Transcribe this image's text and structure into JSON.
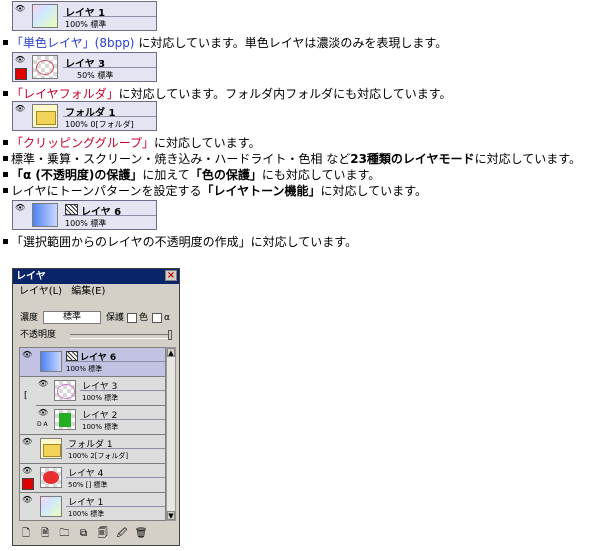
{
  "thumbs": [
    {
      "name": "レイヤ 1",
      "info": "100%   標準"
    },
    {
      "name": "レイヤ 3",
      "info": "50%    標準"
    },
    {
      "name": "フォルダ 1",
      "info": "100%  0[フォルダ]"
    },
    {
      "name": "レイヤ 6",
      "info": "100%   標準"
    }
  ],
  "lines": {
    "l1_link": "「単色レイヤ」(8bpp)",
    "l1_rest": " に対応しています。単色レイヤは濃淡のみを表現します。",
    "l2_red": "「レイヤフォルダ」",
    "l2_rest": "に対応しています。フォルダ内フォルダにも対応しています。",
    "l3_red": "「クリッピンググループ」",
    "l3_rest": "に対応しています。",
    "l4_a": "標準・乗算・スクリーン・焼き込み・ハードライト・色相 など",
    "l4_b": "23種類のレイヤモード",
    "l4_c": "に対応しています。",
    "l5_a": "「α (不透明度)の保護」",
    "l5_b": "に加えて",
    "l5_c": "「色の保護」",
    "l5_d": "にも対応しています。",
    "l6_a": "レイヤにトーンパターンを設定する",
    "l6_b": "「レイヤトーン機能」",
    "l6_c": "に対応しています。",
    "l7": "「選択範囲からのレイヤの不透明度の作成」に対応しています。"
  },
  "panel": {
    "title": "レイヤ",
    "close": "×",
    "menu": [
      "レイヤ(L)",
      "編集(E)"
    ],
    "mode_label": "濃度",
    "mode_value": "標準",
    "protect_label": "保護",
    "protect_color": "色",
    "protect_alpha": "α",
    "opacity_label": "不透明度",
    "rows": [
      {
        "name": "レイヤ 6",
        "info": "100%     標準"
      },
      {
        "name": "レイヤ 3",
        "info": "100%     標準"
      },
      {
        "name": "レイヤ 2",
        "info": "100%     標準"
      },
      {
        "name": "フォルダ 1",
        "info": "100%  2[フォルダ]"
      },
      {
        "name": "レイヤ 4",
        "info": "50% [] 標準"
      },
      {
        "name": "レイヤ 1",
        "info": "100%     標準"
      }
    ],
    "clip_mark": "[",
    "row2_flag": "D A",
    "tools": [
      "🗋",
      "🗎",
      "🗀",
      "⧉",
      "🗐",
      "🖉",
      "🗑"
    ]
  },
  "colors": {
    "selected_row": "#c2c2e2",
    "title_bar": "#0a246a",
    "red_text": "#c8002a",
    "blue_text": "#2a3ed0"
  }
}
